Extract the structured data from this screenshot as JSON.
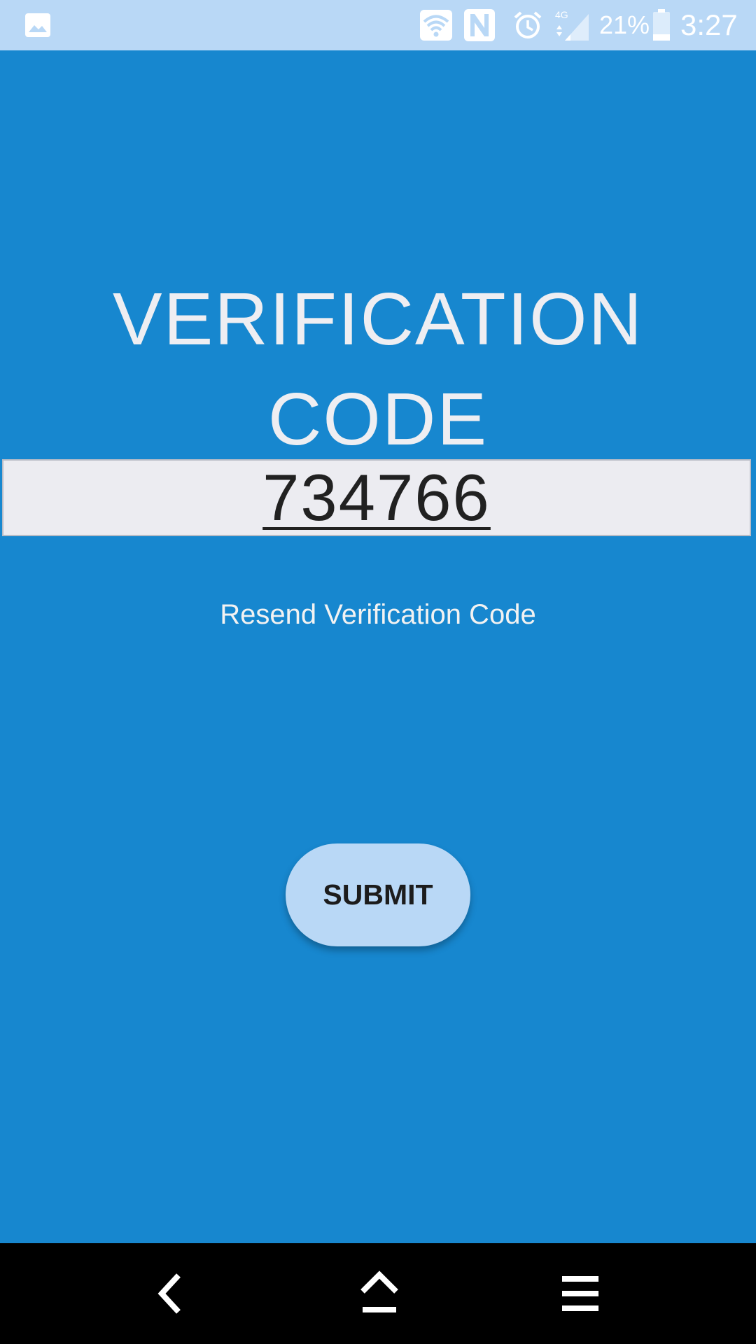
{
  "status_bar": {
    "icons": [
      "gallery-icon",
      "wifi-icon",
      "nfc-icon",
      "alarm-icon",
      "signal-4g-icon",
      "battery-icon"
    ],
    "battery_text": "21%",
    "time": "3:27"
  },
  "main": {
    "title_line1": "VERIFICATION",
    "title_line2": "CODE",
    "code_value": "734766",
    "resend_label": "Resend Verification Code",
    "submit_label": "SUBMIT"
  },
  "nav_bar": {
    "icons": [
      "back-icon",
      "home-icon",
      "menu-icon"
    ]
  },
  "colors": {
    "background": "#1787cf",
    "status_bar": "#b9d8f6",
    "button": "#b9d8f6",
    "field": "#ececf1"
  }
}
